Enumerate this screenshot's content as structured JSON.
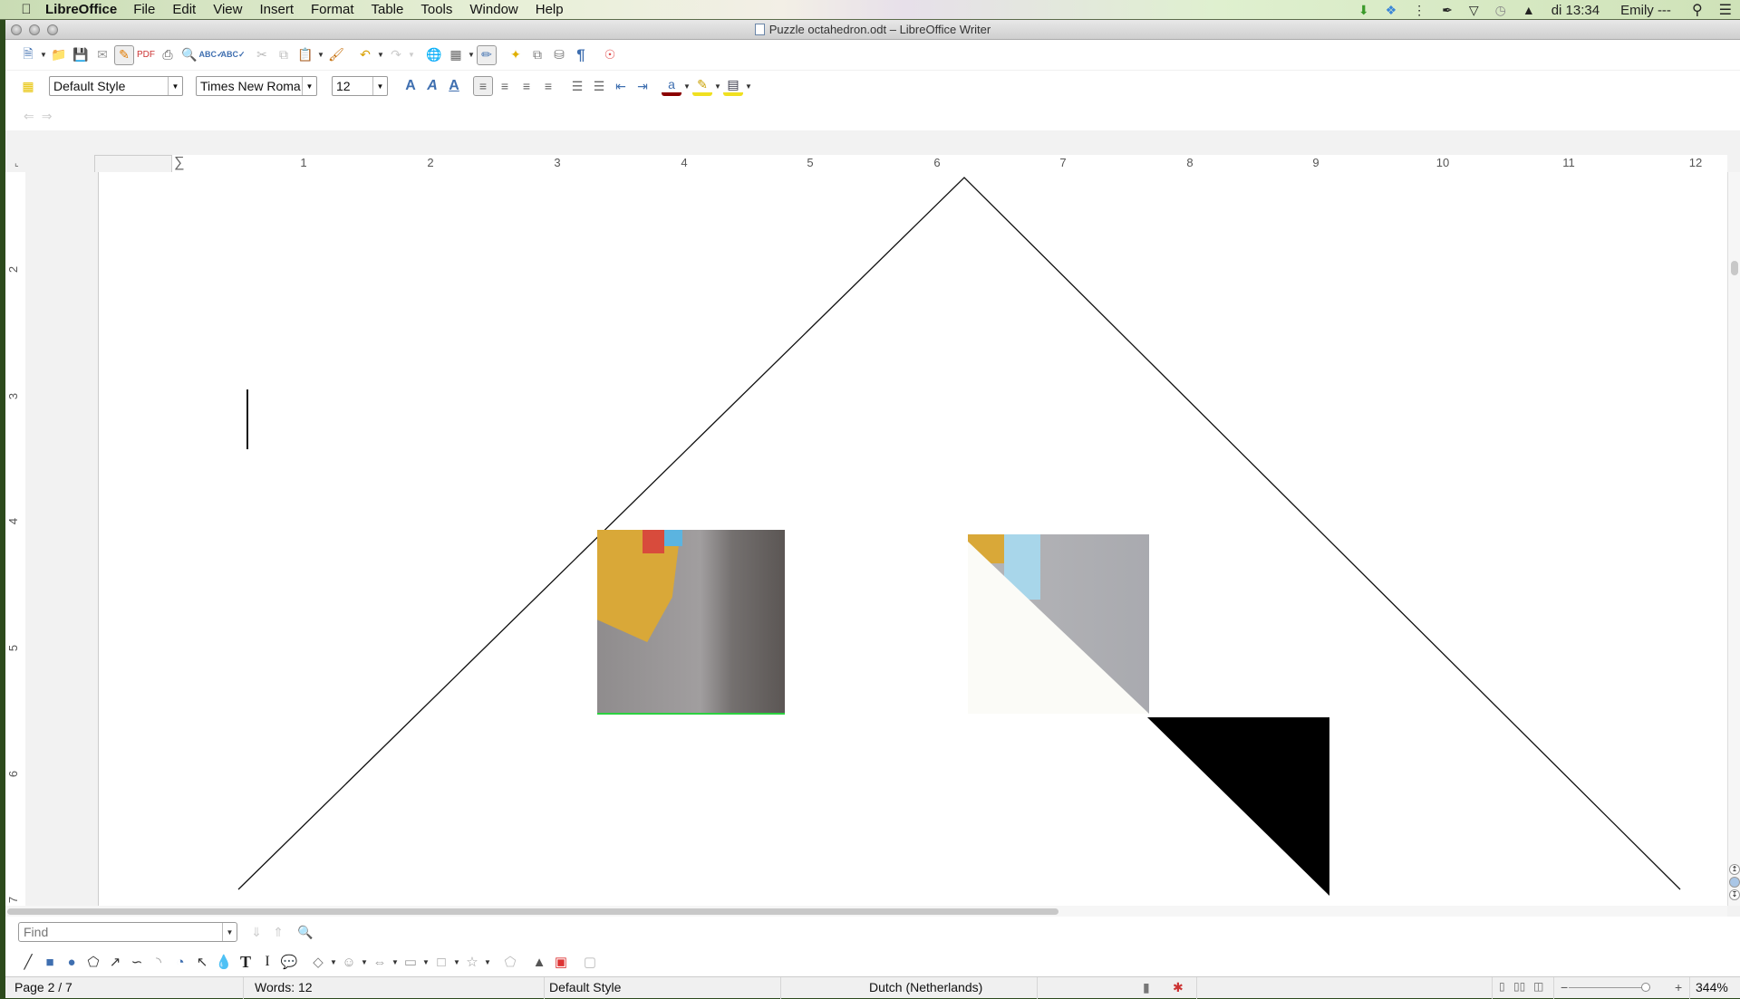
{
  "menubar": {
    "app": "LibreOffice",
    "menus": [
      "File",
      "Edit",
      "View",
      "Insert",
      "Format",
      "Table",
      "Tools",
      "Window",
      "Help"
    ],
    "clock": "di 13:34",
    "user": "Emily ---"
  },
  "window": {
    "title": "Puzzle octahedron.odt – LibreOffice Writer"
  },
  "formatting": {
    "paragraph_style": "Default Style",
    "font_name": "Times New Roma",
    "font_size": "12"
  },
  "ruler": {
    "h_labels": [
      "1",
      "2",
      "3",
      "4",
      "5",
      "6",
      "7",
      "8",
      "9",
      "10",
      "11",
      "12"
    ],
    "v_labels": [
      "2",
      "3",
      "4",
      "5",
      "6",
      "7"
    ]
  },
  "find": {
    "placeholder": "Find"
  },
  "status": {
    "page": "Page 2 / 7",
    "words": "Words: 12",
    "style": "Default Style",
    "language": "Dutch (Netherlands)",
    "zoom": "344%",
    "zoom_percent": 344
  },
  "colors": {
    "accent": "#3f6fb0",
    "triangle_fill": "#000000"
  }
}
